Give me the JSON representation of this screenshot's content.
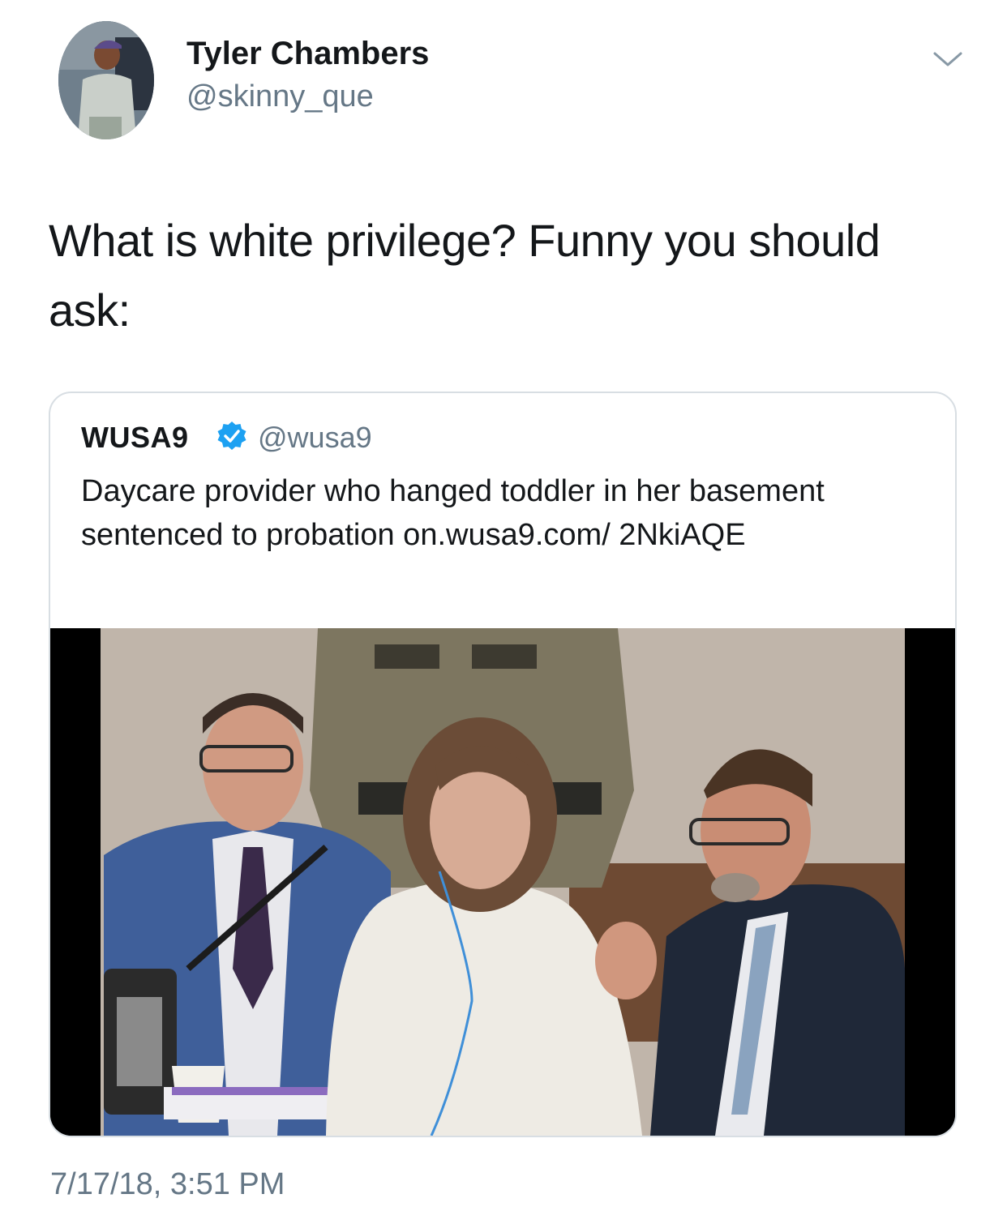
{
  "author": {
    "name": "Tyler Chambers",
    "handle": "@skinny_que"
  },
  "tweet": {
    "text": "What is white privilege? Funny you should ask:",
    "timestamp": "7/17/18, 3:51 PM"
  },
  "quoted": {
    "name": "WUSA9",
    "handle": "@wusa9",
    "verified": true,
    "text": "Daycare provider who hanged toddler in her basement sentenced to probation on.wusa9.com/ 2NkiAQE"
  },
  "icons": {
    "caret": "chevron-down-icon",
    "verified": "verified-badge-icon"
  },
  "colors": {
    "text": "#14171a",
    "secondary": "#657786",
    "verified": "#1da1f2",
    "border": "#d8dee3"
  }
}
